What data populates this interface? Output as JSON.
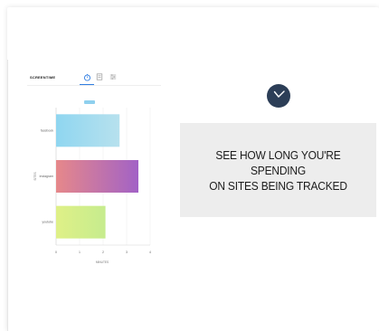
{
  "popup": {
    "title": "SCREENTIME",
    "tabs": [
      {
        "name": "timer-tab",
        "icon": "stopwatch-icon",
        "active": true
      },
      {
        "name": "list-tab",
        "icon": "list-icon",
        "active": false
      },
      {
        "name": "settings-tab",
        "icon": "sliders-icon",
        "active": false
      }
    ]
  },
  "chart_data": {
    "type": "bar",
    "orientation": "horizontal",
    "categories": [
      "facebook",
      "instagram",
      "youtube"
    ],
    "values": [
      2.7,
      3.5,
      2.1
    ],
    "ylabel": "SITES",
    "xlabel": "MINUTES",
    "xlim": [
      0,
      4
    ],
    "xticks": [
      "0",
      "1",
      "2",
      "3",
      "4"
    ],
    "grid": true,
    "legend": "top",
    "bar_gradients": [
      [
        "#8fd6f0",
        "#b7e1ee"
      ],
      [
        "#e6888a",
        "#a262c6"
      ],
      [
        "#dff087",
        "#c6ec8e"
      ]
    ]
  },
  "info": {
    "icon": "clock-icon",
    "text": "SEE HOW LONG YOU'RE SPENDING\nON SITES BEING TRACKED"
  },
  "colors": {
    "clock": "#2c3e57",
    "accent": "#2f7de1",
    "info_bg": "#ededed"
  }
}
